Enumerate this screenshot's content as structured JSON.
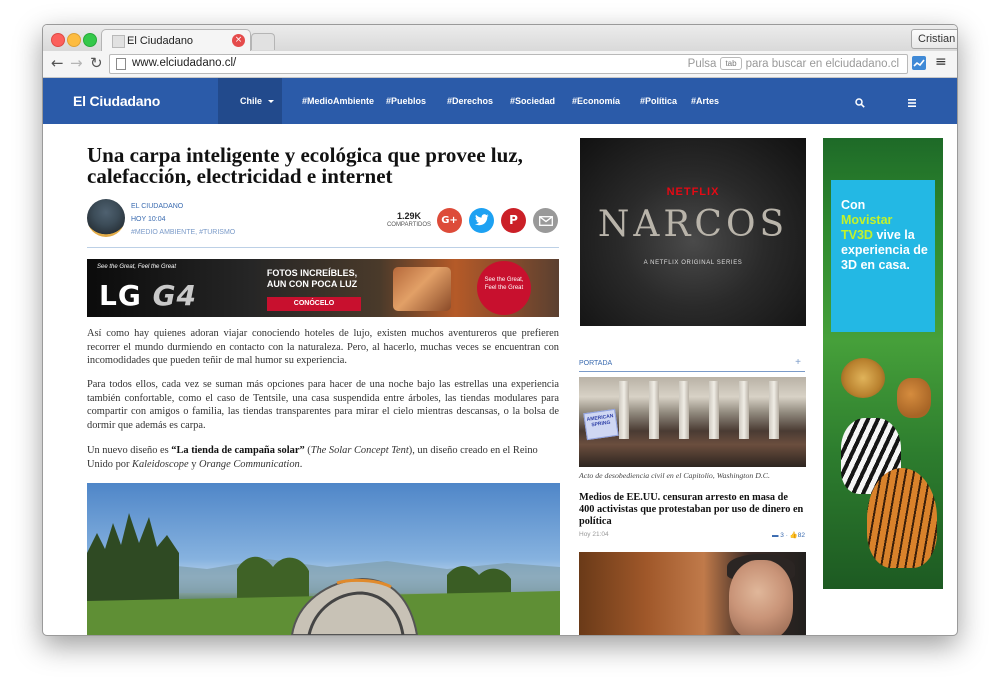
{
  "browser": {
    "tab_title": "El Ciudadano",
    "favicon_text": "El Ciudadano",
    "profile_name": "Cristian",
    "url": "www.elciudadano.cl/",
    "search_hint_pre": "Pulsa",
    "search_hint_key": "tab",
    "search_hint_post": "para buscar en elciudadano.cl"
  },
  "site": {
    "logo": "El Ciudadano",
    "country": "Chile",
    "nav": [
      "#MedioAmbiente",
      "#Pueblos",
      "#Derechos",
      "#Sociedad",
      "#Economía",
      "#Política",
      "#Artes"
    ]
  },
  "article": {
    "headline": "Una carpa inteligente y ecológica que provee luz, calefacción, electricidad e internet",
    "author": "EL CIUDADANO",
    "date": "HOY 10:04",
    "tags": "#MEDIO AMBIENTE, #TURISMO",
    "shares_count": "1.29K",
    "shares_label": "COMPARTIDOS",
    "p1": "Así como hay quienes adoran viajar conociendo hoteles de lujo, existen muchos aventureros que prefieren recorrer el mundo durmiendo en contacto con la naturaleza. Pero, al hacerlo, muchas veces se encuentran con incomodidades que pueden teñir de mal humor su experiencia.",
    "p2": "Para todos ellos, cada vez se suman más opciones para hacer de una noche bajo las estrellas una experiencia también confortable, como el caso de Tentsile, una casa suspendida entre árboles, las tiendas modulares para compartir con amigos o familia, las tiendas transparentes para mirar el cielo mientras descansas, o la bolsa de dormir que además es carpa.",
    "p3_a": "Un nuevo diseño es ",
    "p3_b": "“La tienda de campaña solar”",
    "p3_c": " (",
    "p3_d": "The Solar Concept Tent",
    "p3_e": "), un diseño creado en el Reino Unido por ",
    "p3_f": "Kaleidoscope",
    "p3_g": " y ",
    "p3_h": "Orange Communication",
    "p3_i": "."
  },
  "ads": {
    "lg_tagline": "See the Great, Feel the Great",
    "lg_brand": "LG",
    "lg_model": "G4",
    "lg_promo": "FOTOS INCREÍBLES, AUN CON POCA LUZ",
    "lg_cta": "CONÓCELO",
    "lg_circle": "See the Great, Feel the Great",
    "netflix": "NETFLIX",
    "narcos": "NARCOS",
    "narcos_sub": "A NETFLIX ORIGINAL SERIES",
    "movistar_1": "Con",
    "movistar_2": "Movistar",
    "movistar_3": "TV3D",
    "movistar_4": "vive la experiencia de 3D en casa."
  },
  "sidebar": {
    "section": "PORTADA",
    "section_plus": "+",
    "sign_text": "AMERICAN SPRING",
    "caption": "Acto de desobediencia civil en el Capitolio, Washington D.C.",
    "title": "Medios de EE.UU. censuran arresto en masa de 400 activistas que protestaban por uso de dinero en política",
    "time": "Hoy 21:04",
    "comments": "3",
    "likes": "82"
  },
  "colors": {
    "nav_bg": "#2b5ba9",
    "accent_link": "#3a6bb0",
    "netflix_red": "#e50914",
    "movistar_cyan": "#23b8e4"
  }
}
